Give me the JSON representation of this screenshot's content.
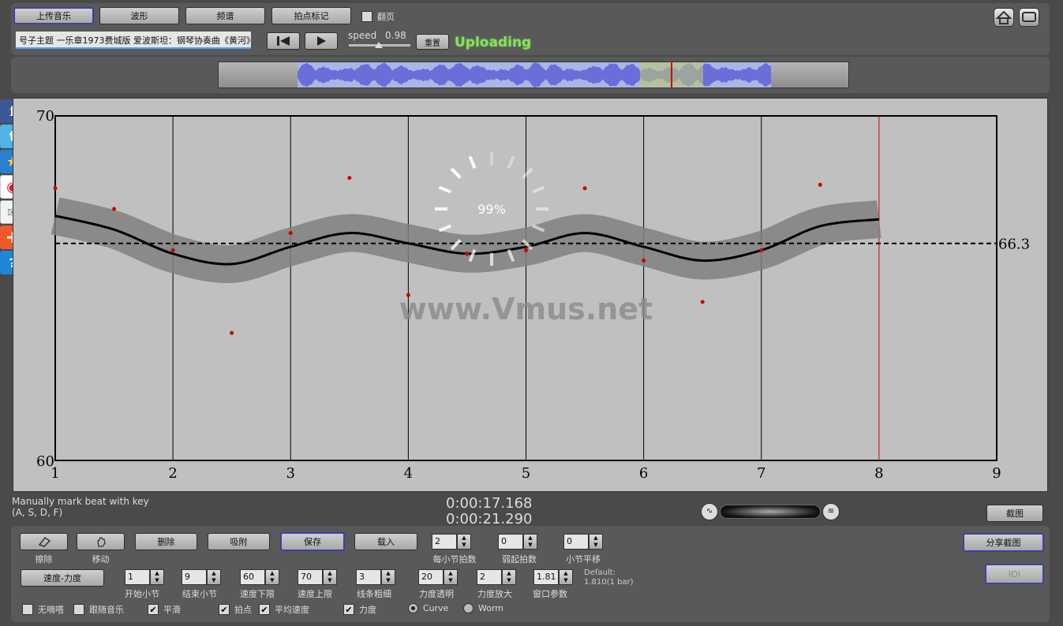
{
  "toolbar": {
    "upload_label": "上传音乐",
    "waveform_label": "波形",
    "spectrum_label": "频谱",
    "beat_mark_label": "拍点标记",
    "page_turn_label": "翻页",
    "track_title": "号子主题 一乐章1973费城版 爱波斯坦：钢琴协奏曲《黄河》",
    "speed_label": "speed",
    "speed_value": "0.98",
    "speed_fraction": 0.49,
    "reset_label": "重置",
    "status": "Uploading"
  },
  "chart": {
    "ymin_label": "70",
    "ymin_bottom_label": "60",
    "ref_value_label": "66.3",
    "watermark": "www.Vmus.net",
    "progress_text": "99%",
    "x_ticks": [
      "1",
      "2",
      "3",
      "4",
      "5",
      "6",
      "7",
      "8",
      "9"
    ]
  },
  "chart_data": {
    "type": "scatter",
    "title": "",
    "xlabel": "",
    "ylabel": "",
    "xlim": [
      1,
      9
    ],
    "ylim": [
      60,
      70
    ],
    "reference_line": 66.3,
    "current_position": 8,
    "x_ticks": [
      1,
      2,
      3,
      4,
      5,
      6,
      7,
      8,
      9
    ],
    "y_ticks": [
      60,
      70
    ],
    "points": [
      [
        1.0,
        67.9
      ],
      [
        1.5,
        67.3
      ],
      [
        2.0,
        66.1
      ],
      [
        2.5,
        63.7
      ],
      [
        3.0,
        66.6
      ],
      [
        3.5,
        68.2
      ],
      [
        4.0,
        64.8
      ],
      [
        4.5,
        66.0
      ],
      [
        5.0,
        66.1
      ],
      [
        5.5,
        67.9
      ],
      [
        6.0,
        65.8
      ],
      [
        6.5,
        64.6
      ],
      [
        7.0,
        66.1
      ],
      [
        7.5,
        68.0
      ]
    ],
    "curve": [
      [
        1.0,
        67.1
      ],
      [
        1.5,
        66.7
      ],
      [
        2.0,
        66.0
      ],
      [
        2.5,
        65.7
      ],
      [
        3.0,
        66.2
      ],
      [
        3.5,
        66.6
      ],
      [
        4.0,
        66.3
      ],
      [
        4.5,
        66.0
      ],
      [
        5.0,
        66.2
      ],
      [
        5.5,
        66.6
      ],
      [
        6.0,
        66.2
      ],
      [
        6.5,
        65.8
      ],
      [
        7.0,
        66.1
      ],
      [
        7.5,
        66.8
      ],
      [
        8.0,
        67.0
      ]
    ]
  },
  "hint": {
    "line1": "Manually mark beat with key",
    "line2": "(A, S, D, F)"
  },
  "time": {
    "current": "0:00:17.168",
    "total": "0:00:21.290"
  },
  "screenshot_label": "截图",
  "share_label": "分享截图",
  "controls": {
    "erase_label": "擦除",
    "move_label": "移动",
    "delete_label": "删除",
    "snap_label": "吸附",
    "save_label": "保存",
    "load_label": "载入",
    "beats_per_bar_label": "每小节拍数",
    "beats_per_bar": "2",
    "pickup_label": "弱起拍数",
    "pickup": "0",
    "bar_shift_label": "小节平移",
    "bar_shift": "0",
    "mode_label": "速度-力度",
    "start_bar_label": "开始小节",
    "start_bar": "1",
    "end_bar_label": "结束小节",
    "end_bar": "9",
    "tempo_min_label": "速度下限",
    "tempo_min": "60",
    "tempo_max_label": "速度上限",
    "tempo_max": "70",
    "line_width_label": "线条粗细",
    "line_width": "3",
    "opacity_label": "力度透明",
    "opacity": "20",
    "dyn_scale_label": "力度放大",
    "dyn_scale": "2",
    "window_label": "窗口参数",
    "window": "1.81",
    "default_label": "Default:",
    "default_value": "1.810(1 bar)",
    "io_label": "IOI"
  },
  "options": {
    "no_click": "无嘀嗒",
    "follow_music": "跟随音乐",
    "smooth": "平滑",
    "beat_points": "拍点",
    "avg_tempo": "平均速度",
    "dynamics": "力度",
    "curve": "Curve",
    "worm": "Worm"
  },
  "colors": {
    "facebook": "#3b5998",
    "twitter": "#4fb4e8",
    "qzone": "#2a7fd0",
    "weibo": "#e6162d",
    "mail": "#d8d8d8",
    "plus": "#f05a28",
    "help": "#1e88d6"
  },
  "icons": {
    "home": "home-icon",
    "fullscreen": "fullscreen-icon"
  }
}
